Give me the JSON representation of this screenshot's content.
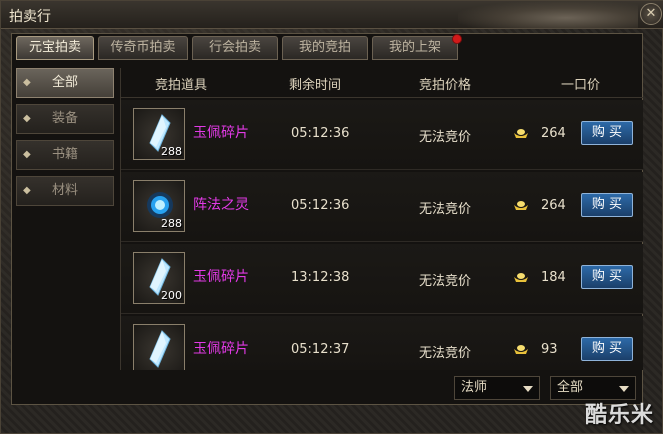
{
  "window": {
    "title": "拍卖行"
  },
  "tabs": [
    {
      "label": "元宝拍卖",
      "active": true
    },
    {
      "label": "传奇币拍卖",
      "active": false
    },
    {
      "label": "行会拍卖",
      "active": false
    },
    {
      "label": "我的竞拍",
      "active": false
    },
    {
      "label": "我的上架",
      "active": false,
      "badge": true
    }
  ],
  "categories": [
    {
      "label": "全部",
      "active": true
    },
    {
      "label": "装备",
      "active": false
    },
    {
      "label": "书籍",
      "active": false
    },
    {
      "label": "材料",
      "active": false
    }
  ],
  "table": {
    "headers": [
      "竞拍道具",
      "剩余时间",
      "竞拍价格",
      "一口价"
    ],
    "rows": [
      {
        "icon": "crystal-shard-icon",
        "count": "288",
        "name": "玉佩碎片",
        "time": "05:12:36",
        "bid": "无法竞价",
        "buyout": "264",
        "action": "购 买"
      },
      {
        "icon": "blue-orb-icon",
        "count": "288",
        "name": "阵法之灵",
        "time": "05:12:36",
        "bid": "无法竞价",
        "buyout": "264",
        "action": "购 买"
      },
      {
        "icon": "crystal-shard-icon",
        "count": "200",
        "name": "玉佩碎片",
        "time": "13:12:38",
        "bid": "无法竞价",
        "buyout": "184",
        "action": "购 买"
      },
      {
        "icon": "crystal-shard-icon",
        "count": "",
        "name": "玉佩碎片",
        "time": "05:12:37",
        "bid": "无法竞价",
        "buyout": "93",
        "action": "购 买"
      }
    ]
  },
  "filters": {
    "class": "法师",
    "type": "全部"
  },
  "watermark": "酷乐米",
  "colors": {
    "item_name": "#e23ae6",
    "buy_button": "#2d6aa8",
    "badge": "#d11a1a",
    "ingot": "#e9c13a"
  }
}
